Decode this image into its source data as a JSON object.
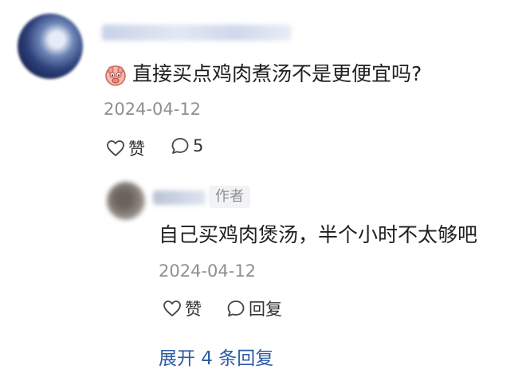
{
  "comment": {
    "text": "直接买点鸡肉煮汤不是更便宜吗?",
    "date": "2024-04-12",
    "like_label": "赞",
    "reply_count": "5"
  },
  "reply": {
    "badge": "作者",
    "text": "自己买鸡肉煲汤，半个小时不太够吧",
    "date": "2024-04-12",
    "like_label": "赞",
    "reply_label": "回复"
  },
  "expand_label": "展开 4 条回复",
  "colors": {
    "link": "#2c5aa6",
    "meta": "#8d8f94"
  }
}
